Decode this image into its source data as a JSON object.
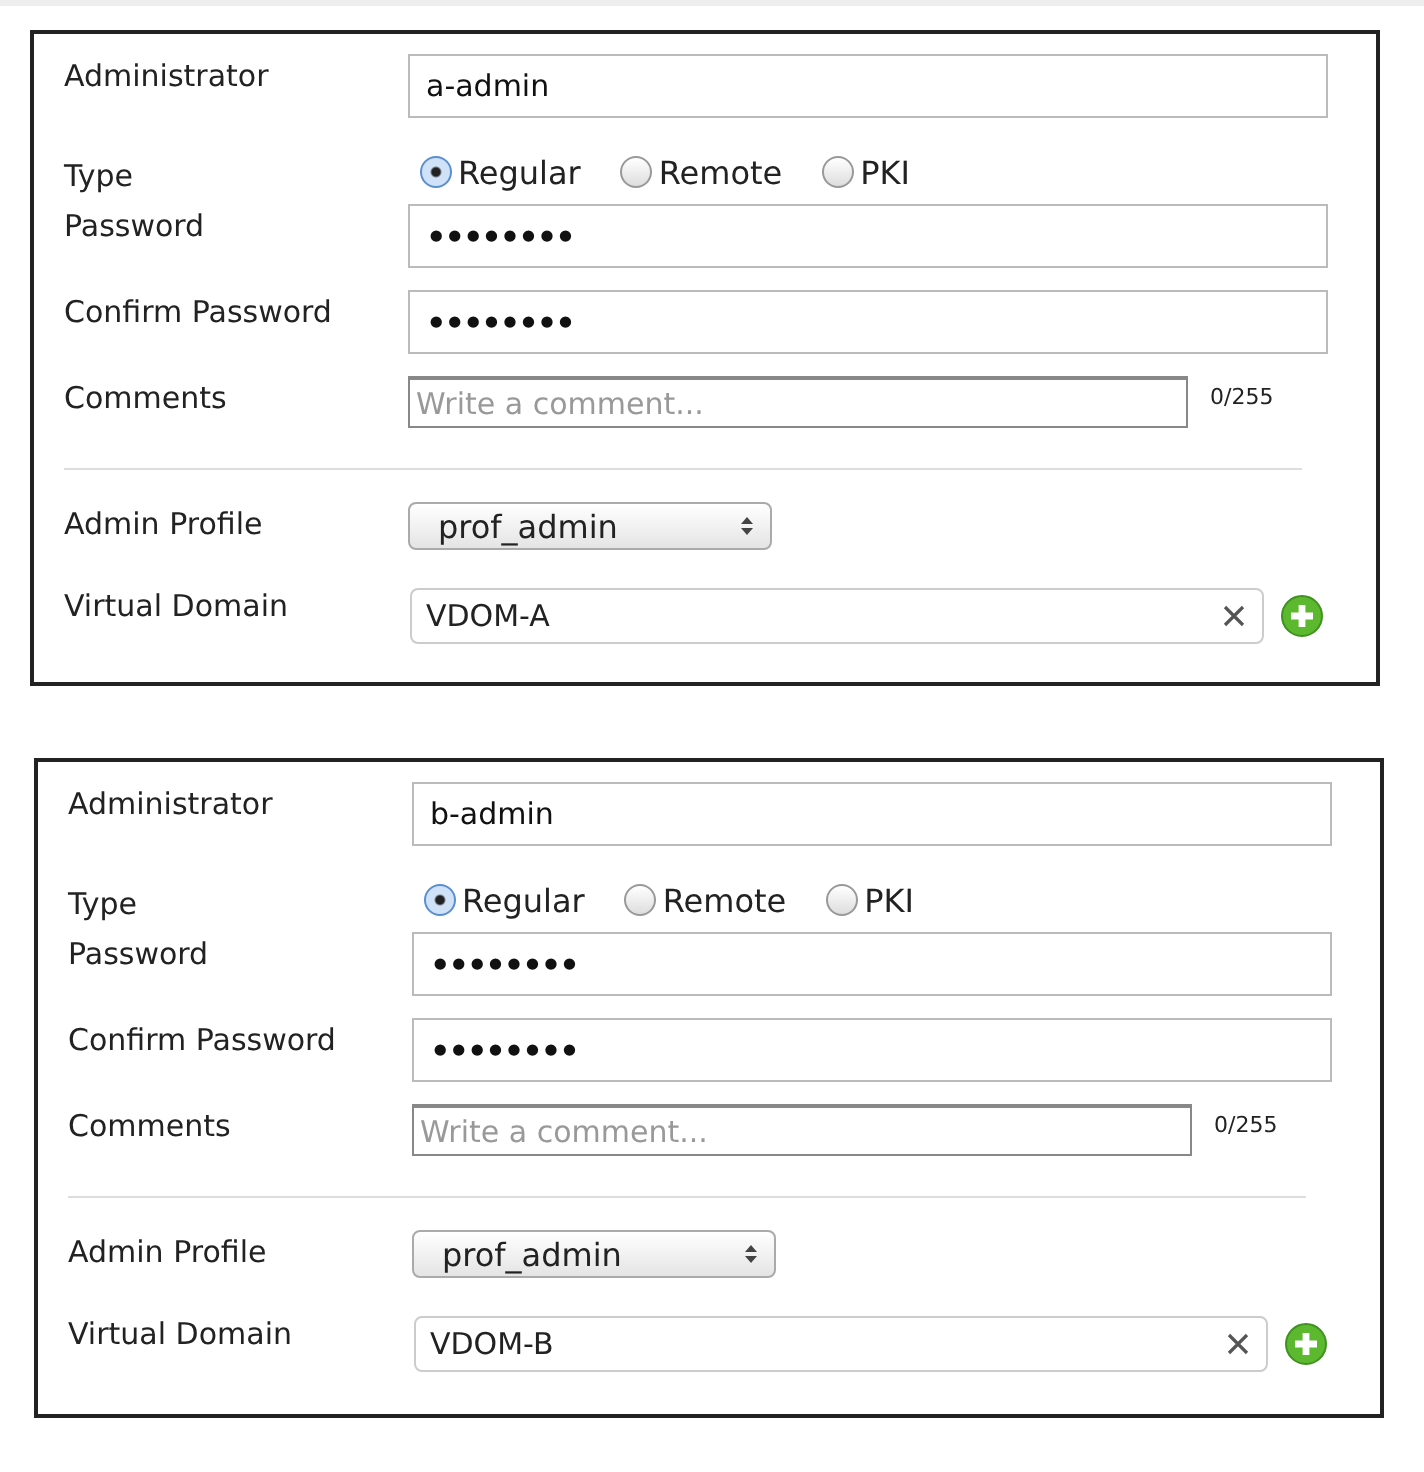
{
  "panels": [
    {
      "administrator": "a-admin",
      "type_label": "Type",
      "types": [
        {
          "label": "Regular",
          "selected": true
        },
        {
          "label": "Remote",
          "selected": false
        },
        {
          "label": "PKI",
          "selected": false
        }
      ],
      "labels": {
        "administrator": "Administrator",
        "password": "Password",
        "confirm": "Confirm Password",
        "comments": "Comments",
        "profile": "Admin Profile",
        "vdom": "Virtual Domain"
      },
      "password": "••••••••",
      "confirm_password": "••••••••",
      "comments": {
        "placeholder": "Write a comment...",
        "count": "0/255"
      },
      "admin_profile": "prof_admin",
      "virtual_domain": "VDOM-A"
    },
    {
      "administrator": "b-admin",
      "type_label": "Type",
      "types": [
        {
          "label": "Regular",
          "selected": true
        },
        {
          "label": "Remote",
          "selected": false
        },
        {
          "label": "PKI",
          "selected": false
        }
      ],
      "labels": {
        "administrator": "Administrator",
        "password": "Password",
        "confirm": "Confirm Password",
        "comments": "Comments",
        "profile": "Admin Profile",
        "vdom": "Virtual Domain"
      },
      "password": "••••••••",
      "confirm_password": "••••••••",
      "comments": {
        "placeholder": "Write a comment...",
        "count": "0/255"
      },
      "admin_profile": "prof_admin",
      "virtual_domain": "VDOM-B"
    }
  ]
}
